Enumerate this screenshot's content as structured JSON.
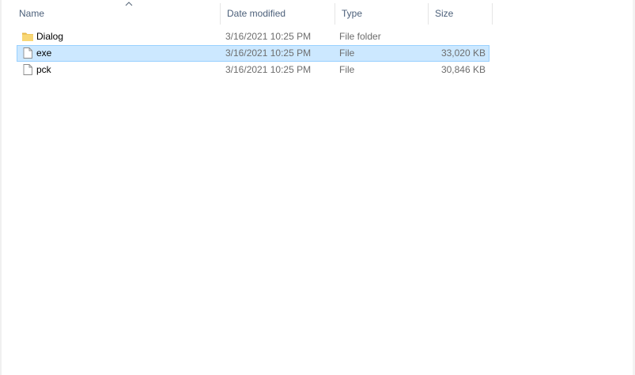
{
  "columns": {
    "name": "Name",
    "date_modified": "Date modified",
    "type": "Type",
    "size": "Size"
  },
  "sort": {
    "column": "name",
    "direction": "ascending",
    "icon": "chevron-up-icon"
  },
  "files": [
    {
      "name": "Dialog",
      "date": "3/16/2021 10:25 PM",
      "type": "File folder",
      "size": "",
      "icon": "folder-icon",
      "selected": false
    },
    {
      "name": "exe",
      "date": "3/16/2021 10:25 PM",
      "type": "File",
      "size": "33,020 KB",
      "icon": "file-icon",
      "selected": true
    },
    {
      "name": "pck",
      "date": "3/16/2021 10:25 PM",
      "type": "File",
      "size": "30,846 KB",
      "icon": "file-icon",
      "selected": false
    }
  ],
  "colors": {
    "selection_bg": "#cce8ff",
    "selection_border": "#99d1ff",
    "header_text": "#4c607a",
    "folder": "#f8d775"
  }
}
